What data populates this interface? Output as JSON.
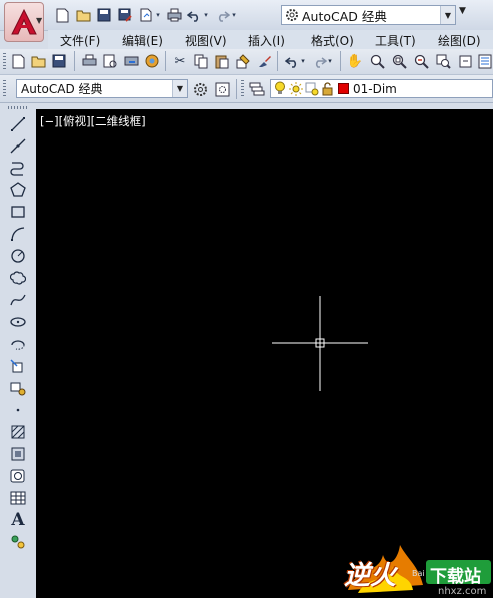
{
  "app": {
    "name": "AutoCAD",
    "logo_letter": "A"
  },
  "title_bar": {
    "workspace_label": "AutoCAD 经典",
    "quick_access": [
      "new-icon",
      "open-icon",
      "save-icon",
      "saveas-icon",
      "publish-icon",
      "print-icon",
      "undo-icon",
      "redo-icon"
    ]
  },
  "menu": [
    "文件(F)",
    "编辑(E)",
    "视图(V)",
    "插入(I)",
    "格式(O)",
    "工具(T)",
    "绘图(D)"
  ],
  "standard_toolbar": [
    "new-icon",
    "open-icon",
    "save-icon",
    "print-icon",
    "preview-icon",
    "plot-icon",
    "3d-dwf-icon",
    "cut-icon",
    "copy-icon",
    "paste-icon",
    "match-properties-icon",
    "brush-icon",
    "undo-icon",
    "redo-icon",
    "pan-icon",
    "zoom-realtime-icon",
    "zoom-window-icon",
    "zoom-previous-icon"
  ],
  "workspace_toolbar": {
    "workspace": "AutoCAD 经典"
  },
  "layer_toolbar": {
    "current_layer": "01-Dim",
    "layer_color": "#e00000"
  },
  "draw_toolbar": [
    "line-icon",
    "construction-line-icon",
    "polyline-icon",
    "polygon-icon",
    "rectangle-icon",
    "arc-icon",
    "circle-icon",
    "revision-cloud-icon",
    "spline-icon",
    "ellipse-icon",
    "ellipse-arc-icon",
    "insert-block-icon",
    "make-block-icon",
    "point-icon",
    "hatch-icon",
    "gradient-icon",
    "region-icon",
    "table-icon",
    "multiline-text-icon",
    "add-selected-icon"
  ],
  "viewport": {
    "label": "[−][俯视][二维线框]",
    "background": "#000000",
    "crosshair_color": "#ffffff"
  },
  "watermark": {
    "brand": "逆火",
    "site_label": "下载站",
    "url": "nhxz.com",
    "small": "Bai"
  }
}
